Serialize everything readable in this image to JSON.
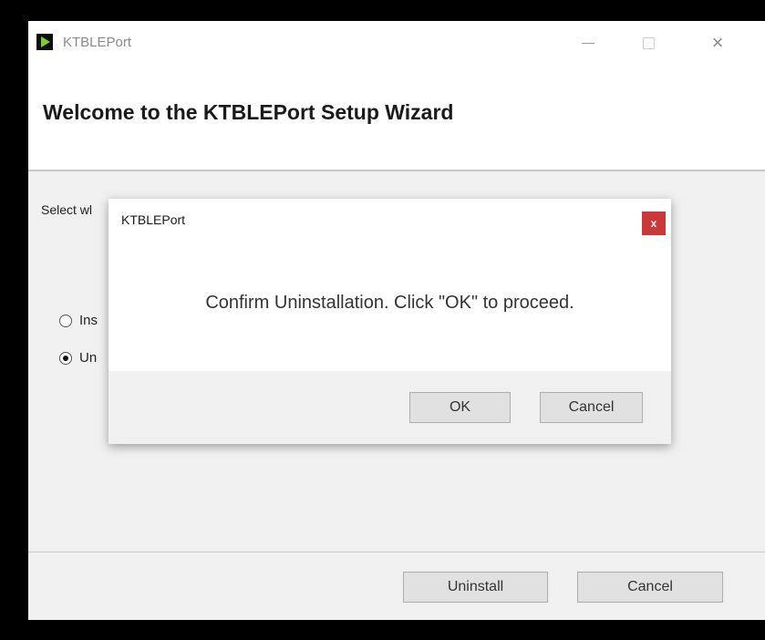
{
  "window": {
    "title": "KTBLEPort",
    "icon": "ktbleport-app-icon",
    "controls": {
      "minimize": "minimize-icon",
      "maximize": "maximize-icon",
      "close": "×"
    }
  },
  "wizard": {
    "heading": "Welcome to the KTBLEPort Setup Wizard",
    "prompt": "Select wl",
    "options": [
      {
        "label": "Ins",
        "selected": false
      },
      {
        "label": "Un",
        "selected": true
      }
    ],
    "buttons": {
      "uninstall": "Uninstall",
      "cancel": "Cancel"
    }
  },
  "dialog": {
    "title": "KTBLEPort",
    "close_label": "x",
    "message": "Confirm Uninstallation. Click \"OK\" to proceed.",
    "buttons": {
      "ok": "OK",
      "cancel": "Cancel"
    }
  },
  "colors": {
    "dialog_close": "#c83a3a",
    "app_icon_accent": "#7ed321"
  }
}
